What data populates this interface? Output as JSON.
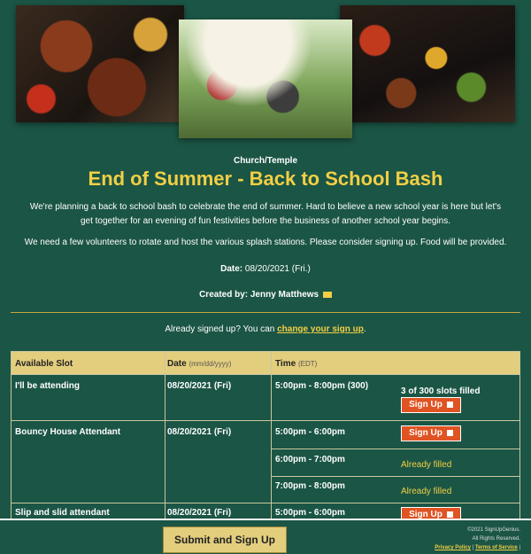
{
  "event": {
    "category": "Church/Temple",
    "title": "End of Summer - Back to School Bash",
    "description": "We're planning a back to school bash to celebrate the end of summer. Hard to believe a new school year is here but let's get together for an evening of fun festivities before the business of another school year begins.",
    "volunteers": "We need a few volunteers to rotate and host the various splash stations. Please consider signing up. Food will be provided.",
    "date_label": "Date:",
    "date_value": "08/20/2021 (Fri.)",
    "created_label": "Created by:",
    "created_value": "Jenny Matthews"
  },
  "signup_notice": {
    "prefix": "Already signed up? You can",
    "link": "change your sign up",
    "suffix": "."
  },
  "table": {
    "headers": {
      "slot": "Available Slot",
      "date": "Date",
      "date_fmt": "(mm/dd/yyyy)",
      "time": "Time",
      "time_zone": "(EDT)"
    },
    "rows": [
      {
        "slot": "I'll be attending",
        "date": "08/20/2021 (Fri)",
        "times": [
          {
            "time": "5:00pm - 8:00pm (300)",
            "status": "3 of 300 slots filled",
            "action": "Sign Up"
          }
        ]
      },
      {
        "slot": "Bouncy House Attendant",
        "date": "08/20/2021 (Fri)",
        "times": [
          {
            "time": "5:00pm - 6:00pm",
            "action": "Sign Up"
          },
          {
            "time": "6:00pm - 7:00pm",
            "status": "Already filled"
          },
          {
            "time": "7:00pm - 8:00pm",
            "status": "Already filled"
          }
        ]
      },
      {
        "slot": "Slip and slid attendant",
        "date": "08/20/2021 (Fri)",
        "times": [
          {
            "time": "5:00pm - 6:00pm",
            "action": "Sign Up"
          }
        ]
      }
    ]
  },
  "footer": {
    "submit": "Submit and Sign Up",
    "copyright": "©2021 SignUpGenius.",
    "rights": "All Rights Reserved.",
    "privacy": "Privacy Policy",
    "sep": "|",
    "terms": "Terms of Service",
    "sep2": "|"
  },
  "colors": {
    "background": "#1b5545",
    "accent": "#f2cf45",
    "button": "#e05323",
    "header": "#e3ce7e"
  }
}
